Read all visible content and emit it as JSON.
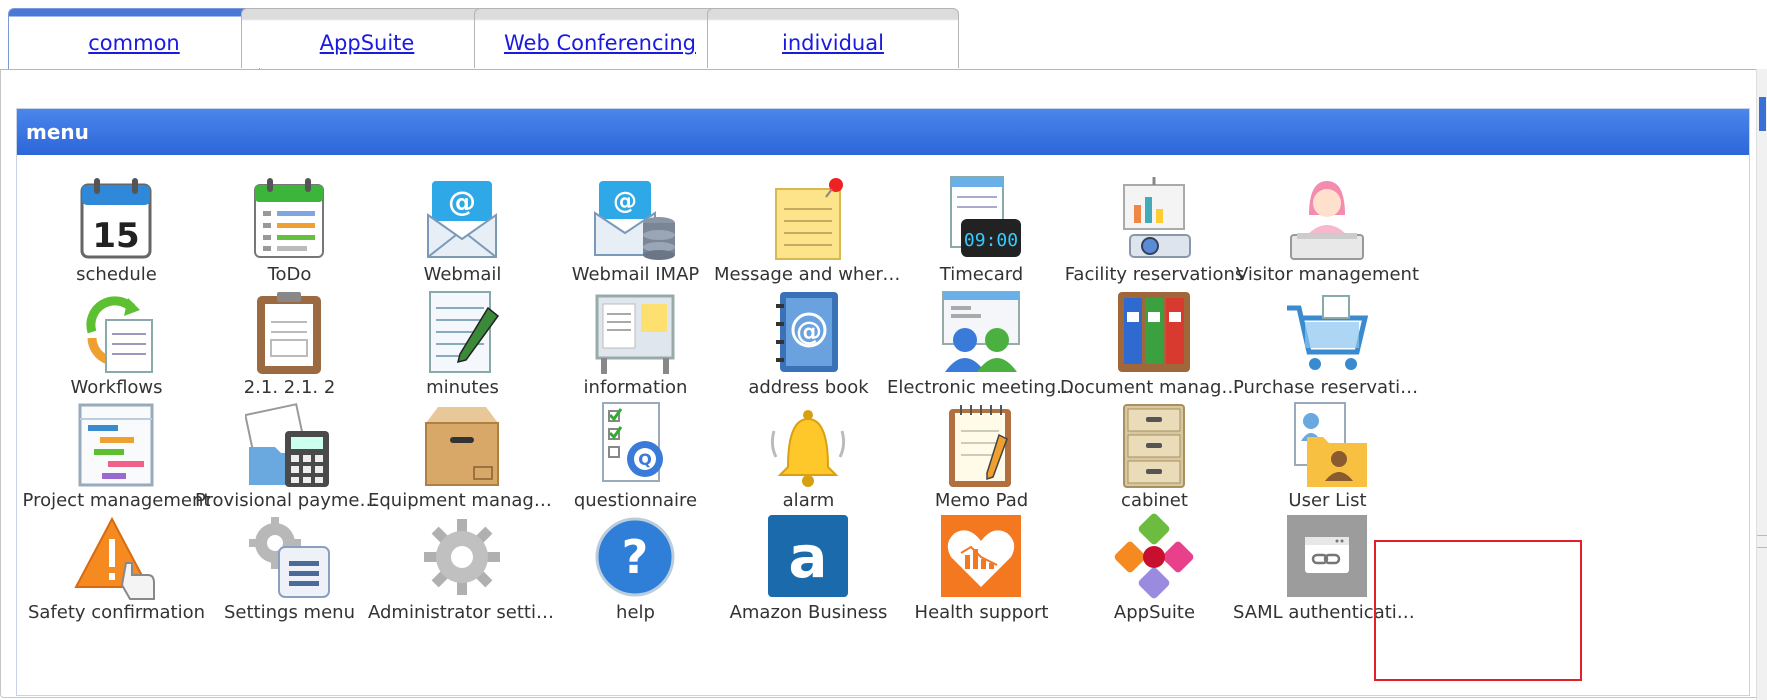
{
  "tabs": [
    {
      "label": "common",
      "active": true
    },
    {
      "label": "AppSuite",
      "active": false
    },
    {
      "label": "Web Conferencing",
      "active": false
    },
    {
      "label": "individual",
      "active": false
    }
  ],
  "menu": {
    "title": "menu",
    "rows": [
      [
        {
          "label": "schedule",
          "icon": "calendar-icon"
        },
        {
          "label": "ToDo",
          "icon": "todo-icon"
        },
        {
          "label": "Webmail",
          "icon": "webmail-icon"
        },
        {
          "label": "Webmail IMAP",
          "icon": "webmail-imap-icon"
        },
        {
          "label": "Message and where…",
          "icon": "sticky-note-icon"
        },
        {
          "label": "Timecard",
          "icon": "timecard-icon"
        },
        {
          "label": "Facility reservations",
          "icon": "projector-icon"
        },
        {
          "label": "Visitor management",
          "icon": "receptionist-icon"
        }
      ],
      [
        {
          "label": "Workflows",
          "icon": "workflow-icon"
        },
        {
          "label": "2.1. 2.1. 2",
          "icon": "clipboard-icon"
        },
        {
          "label": "minutes",
          "icon": "notepad-pen-icon"
        },
        {
          "label": "information",
          "icon": "bulletin-board-icon"
        },
        {
          "label": "address book",
          "icon": "address-book-icon"
        },
        {
          "label": "Electronic meeting r…",
          "icon": "meeting-icon"
        },
        {
          "label": "Document manage…",
          "icon": "binders-icon"
        },
        {
          "label": "Purchase reservations",
          "icon": "shopping-cart-icon"
        }
      ],
      [
        {
          "label": "Project management",
          "icon": "gantt-chart-icon"
        },
        {
          "label": "Provisional paymen…",
          "icon": "calculator-icon"
        },
        {
          "label": "Equipment manage…",
          "icon": "cardboard-box-icon"
        },
        {
          "label": "questionnaire",
          "icon": "questionnaire-icon"
        },
        {
          "label": "alarm",
          "icon": "bell-icon"
        },
        {
          "label": "Memo Pad",
          "icon": "memo-pad-icon"
        },
        {
          "label": "cabinet",
          "icon": "filing-cabinet-icon"
        },
        {
          "label": "User List",
          "icon": "user-folder-icon"
        }
      ],
      [
        {
          "label": "Safety confirmation",
          "icon": "warning-hand-icon"
        },
        {
          "label": "Settings menu",
          "icon": "settings-list-icon"
        },
        {
          "label": "Administrator settings",
          "icon": "gear-icon"
        },
        {
          "label": "help",
          "icon": "help-icon"
        },
        {
          "label": "Amazon Business",
          "icon": "amazon-icon"
        },
        {
          "label": "Health support",
          "icon": "heart-chart-icon"
        },
        {
          "label": "AppSuite",
          "icon": "appsuite-icon"
        },
        {
          "label": "SAML authenticatio…",
          "icon": "saml-link-icon"
        }
      ]
    ]
  },
  "colors": {
    "header_bg": "#3a74e0",
    "tab_link": "#1a1ae0",
    "highlight_border": "#e3202a"
  }
}
